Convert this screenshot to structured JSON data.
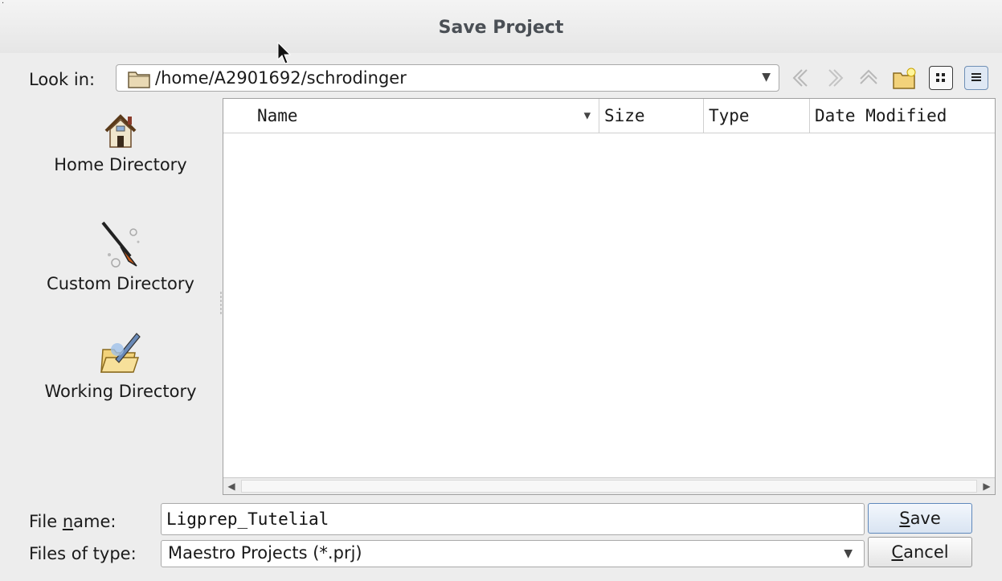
{
  "window": {
    "title": "Save Project"
  },
  "look_in": {
    "label": "Look in:",
    "path": "/home/A2901692/schrodinger"
  },
  "toolbar": {
    "back_icon": "back-arrow-icon",
    "forward_icon": "forward-arrow-icon",
    "up_icon": "parent-directory-icon",
    "new_folder_icon": "new-folder-icon",
    "list_view_icon": "list-view-icon",
    "detail_view_icon": "detail-view-icon"
  },
  "sidebar": {
    "items": [
      {
        "label": "Home Directory",
        "icon": "home-icon"
      },
      {
        "label": "Custom Directory",
        "icon": "rocket-icon"
      },
      {
        "label": "Working Directory",
        "icon": "folder-edit-icon"
      }
    ]
  },
  "file_list": {
    "columns": [
      "Name",
      "Size",
      "Type",
      "Date Modified"
    ],
    "rows": []
  },
  "file_name": {
    "label_pre": "File ",
    "label_mnemonic": "n",
    "label_post": "ame:",
    "value": "Ligprep_Tutelial"
  },
  "file_type": {
    "label": "Files of type:",
    "selected": "Maestro Projects (*.prj)"
  },
  "buttons": {
    "save_mnemonic": "S",
    "save_rest": "ave",
    "cancel_mnemonic": "C",
    "cancel_rest": "ancel"
  },
  "colors": {
    "background": "#ededed",
    "title_text": "#4a4f55",
    "default_button_border": "#5f88bb"
  }
}
